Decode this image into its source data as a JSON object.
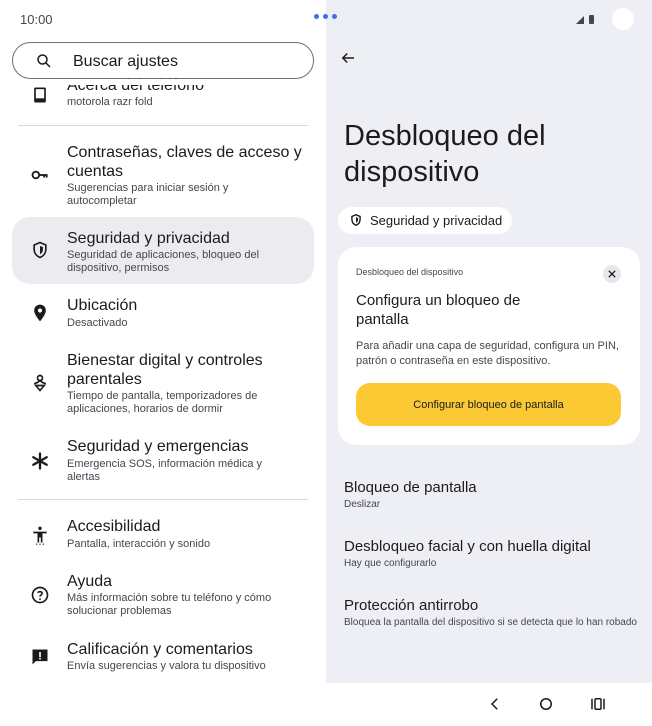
{
  "status": {
    "time": "10:00"
  },
  "search": {
    "placeholder": "Buscar ajustes"
  },
  "settings_list": [
    {
      "icon": "phone-icon",
      "title": "Acerca del teléfono",
      "subtitle": "motorola razr fold"
    },
    {
      "icon": "key-icon",
      "title": "Contraseñas, claves de acceso y cuentas",
      "subtitle": "Sugerencias para iniciar sesión y autocompletar"
    },
    {
      "icon": "shield-icon",
      "title": "Seguridad y privacidad",
      "subtitle": "Seguridad de aplicaciones, bloqueo del dispositivo, permisos"
    },
    {
      "icon": "location-pin-icon",
      "title": "Ubicación",
      "subtitle": "Desactivado"
    },
    {
      "icon": "wellbeing-icon",
      "title": "Bienestar digital y controles parentales",
      "subtitle": "Tiempo de pantalla, temporizadores de aplicaciones, horarios de dormir"
    },
    {
      "icon": "asterisk-icon",
      "title": "Seguridad y emergencias",
      "subtitle": "Emergencia SOS, información médica y alertas"
    },
    {
      "icon": "accessibility-icon",
      "title": "Accesibilidad",
      "subtitle": "Pantalla, interacción y sonido"
    },
    {
      "icon": "help-icon",
      "title": "Ayuda",
      "subtitle": "Más información sobre tu teléfono y cómo solucionar problemas"
    },
    {
      "icon": "feedback-icon",
      "title": "Calificación y comentarios",
      "subtitle": "Envía sugerencias y valora tu dispositivo"
    }
  ],
  "detail": {
    "title": "Desbloqueo del dispositivo",
    "chip_label": "Seguridad y privacidad",
    "card": {
      "eyebrow": "Desbloqueo del dispositivo",
      "title": "Configura un bloqueo de pantalla",
      "body": "Para añadir una capa de seguridad, configura un PIN, patrón o contraseña en este dispositivo.",
      "button_label": "Configurar bloqueo de pantalla"
    },
    "options": [
      {
        "title": "Bloqueo de pantalla",
        "subtitle": "Deslizar"
      },
      {
        "title": "Desbloqueo facial y con huella digital",
        "subtitle": "Hay que configurarlo"
      },
      {
        "title": "Protección antirrobo",
        "subtitle": "Bloquea la pantalla del dispositivo si se detecta que lo han robado"
      }
    ]
  },
  "colors": {
    "accent_button": "#fbc934",
    "detail_background": "#eeeff5",
    "active_item": "#ececf0",
    "dots": "#3f6ff0"
  }
}
